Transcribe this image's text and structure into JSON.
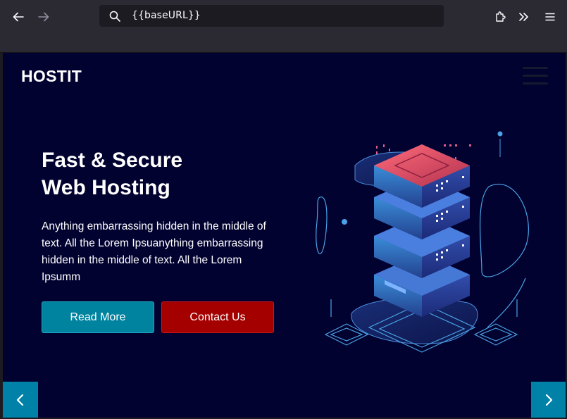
{
  "browser": {
    "url": "{{baseURL}}",
    "icons": [
      "back-arrow-icon",
      "forward-arrow-icon",
      "search-icon",
      "extensions-icon",
      "overflow-chevrons-icon",
      "menu-icon"
    ]
  },
  "site": {
    "brand": "HOSTIT",
    "hero": {
      "title_line1": "Fast & Secure",
      "title_line2": "Web Hosting",
      "text": "Anything embarrassing hidden in the middle of text. All the Lorem Ipsuanything embarrassing hidden in the middle of text. All the Lorem Ipsumm",
      "read_more": "Read More",
      "contact_us": "Contact Us"
    },
    "colors": {
      "background": "#020230",
      "primary": "#00839f",
      "secondary": "#a40000"
    }
  }
}
